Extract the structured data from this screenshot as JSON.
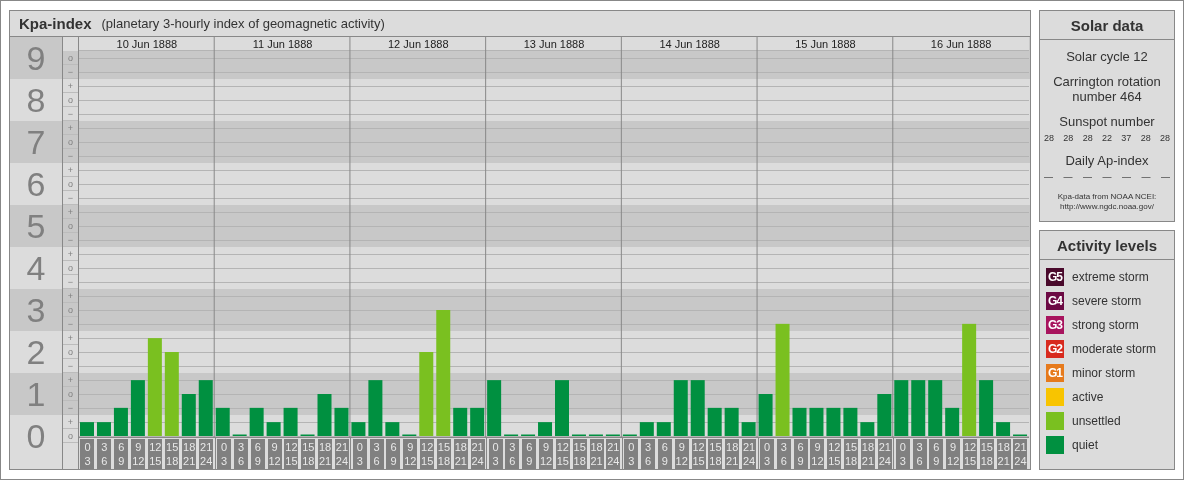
{
  "kp_panel": {
    "title": "Kpa-index",
    "subtitle": "(planetary 3-hourly index of geomagnetic activity)",
    "days": [
      {
        "date": "10 Jun 1888",
        "slots": [
          {
            "from": "0",
            "to": "3"
          },
          {
            "from": "3",
            "to": "6"
          },
          {
            "from": "6",
            "to": "9"
          },
          {
            "from": "9",
            "to": "12"
          },
          {
            "from": "12",
            "to": "15"
          },
          {
            "from": "15",
            "to": "18"
          },
          {
            "from": "18",
            "to": "21"
          },
          {
            "from": "21",
            "to": "24"
          }
        ]
      },
      {
        "date": "11 Jun 1888",
        "slots": [
          {
            "from": "0",
            "to": "3"
          },
          {
            "from": "3",
            "to": "6"
          },
          {
            "from": "6",
            "to": "9"
          },
          {
            "from": "9",
            "to": "12"
          },
          {
            "from": "12",
            "to": "15"
          },
          {
            "from": "15",
            "to": "18"
          },
          {
            "from": "18",
            "to": "21"
          },
          {
            "from": "21",
            "to": "24"
          }
        ]
      },
      {
        "date": "12 Jun 1888",
        "slots": [
          {
            "from": "0",
            "to": "3"
          },
          {
            "from": "3",
            "to": "6"
          },
          {
            "from": "6",
            "to": "9"
          },
          {
            "from": "9",
            "to": "12"
          },
          {
            "from": "12",
            "to": "15"
          },
          {
            "from": "15",
            "to": "18"
          },
          {
            "from": "18",
            "to": "21"
          },
          {
            "from": "21",
            "to": "24"
          }
        ]
      },
      {
        "date": "13 Jun 1888",
        "slots": [
          {
            "from": "0",
            "to": "3"
          },
          {
            "from": "3",
            "to": "6"
          },
          {
            "from": "6",
            "to": "9"
          },
          {
            "from": "9",
            "to": "12"
          },
          {
            "from": "12",
            "to": "15"
          },
          {
            "from": "15",
            "to": "18"
          },
          {
            "from": "18",
            "to": "21"
          },
          {
            "from": "21",
            "to": "24"
          }
        ]
      },
      {
        "date": "14 Jun 1888",
        "slots": [
          {
            "from": "0",
            "to": "3"
          },
          {
            "from": "3",
            "to": "6"
          },
          {
            "from": "6",
            "to": "9"
          },
          {
            "from": "9",
            "to": "12"
          },
          {
            "from": "12",
            "to": "15"
          },
          {
            "from": "15",
            "to": "18"
          },
          {
            "from": "18",
            "to": "21"
          },
          {
            "from": "21",
            "to": "24"
          }
        ]
      },
      {
        "date": "15 Jun 1888",
        "slots": [
          {
            "from": "0",
            "to": "3"
          },
          {
            "from": "3",
            "to": "6"
          },
          {
            "from": "6",
            "to": "9"
          },
          {
            "from": "9",
            "to": "12"
          },
          {
            "from": "12",
            "to": "15"
          },
          {
            "from": "15",
            "to": "18"
          },
          {
            "from": "18",
            "to": "21"
          },
          {
            "from": "21",
            "to": "24"
          }
        ]
      },
      {
        "date": "16 Jun 1888",
        "slots": [
          {
            "from": "0",
            "to": "3"
          },
          {
            "from": "3",
            "to": "6"
          },
          {
            "from": "6",
            "to": "9"
          },
          {
            "from": "9",
            "to": "12"
          },
          {
            "from": "12",
            "to": "15"
          },
          {
            "from": "15",
            "to": "18"
          },
          {
            "from": "18",
            "to": "21"
          },
          {
            "from": "21",
            "to": "24"
          }
        ]
      }
    ],
    "grade_marks": [
      "o",
      "−",
      "+",
      "o",
      "−",
      "+",
      "o",
      "−",
      "+",
      "o",
      "−",
      "+",
      "o",
      "−",
      "+",
      "o",
      "−",
      "+",
      "o",
      "−",
      "+",
      "o",
      "−",
      "+",
      "o",
      "−",
      "+",
      "o"
    ],
    "chart_data": {
      "type": "bar",
      "ylim": [
        0,
        9
      ],
      "grid": true,
      "yticks": [
        {
          "value": 0,
          "label": "0"
        },
        {
          "value": 1,
          "label": "1"
        },
        {
          "value": 2,
          "label": "2"
        },
        {
          "value": 3,
          "label": "3"
        },
        {
          "value": 4,
          "label": "4"
        },
        {
          "value": 5,
          "label": "5"
        },
        {
          "value": 6,
          "label": "6"
        },
        {
          "value": 7,
          "label": "7"
        },
        {
          "value": 8,
          "label": "8"
        },
        {
          "value": 9,
          "label": "9"
        }
      ],
      "values": [
        0.33,
        0.33,
        0.67,
        1.33,
        2.33,
        2.0,
        1.0,
        1.33,
        0.67,
        0,
        0.67,
        0.33,
        0.67,
        0,
        1.0,
        0.67,
        0.33,
        1.33,
        0.33,
        0,
        2.0,
        3.0,
        0.67,
        0.67,
        1.33,
        0,
        0,
        0.33,
        1.33,
        0,
        0,
        0,
        0,
        0.33,
        0.33,
        1.33,
        1.33,
        0.67,
        0.67,
        0.33,
        1.0,
        2.67,
        0.67,
        0.67,
        0.67,
        0.67,
        0.33,
        1.0,
        1.33,
        1.33,
        1.33,
        0.67,
        2.67,
        1.33,
        0.33,
        0
      ]
    }
  },
  "solar_data": {
    "title": "Solar data",
    "solar_cycle": "Solar cycle 12",
    "carrington_rotation": "Carrington rotation number 464",
    "sunspot_heading": "Sunspot number",
    "sunspot_numbers": [
      "28",
      "28",
      "28",
      "22",
      "37",
      "28",
      "28"
    ],
    "ap_heading": "Daily Ap-index",
    "ap_values": [
      "—",
      "—",
      "—",
      "—",
      "—",
      "—",
      "—"
    ],
    "source": "Kpa-data from NOAA NCEI:",
    "source_url": "http://www.ngdc.noaa.gov/"
  },
  "activity_levels": {
    "title": "Activity levels",
    "items": [
      {
        "badge": "G5",
        "label": "extreme storm",
        "color": "#4a0a2c"
      },
      {
        "badge": "G4",
        "label": "severe storm",
        "color": "#6c0a44"
      },
      {
        "badge": "G3",
        "label": "strong storm",
        "color": "#a8145e"
      },
      {
        "badge": "G2",
        "label": "moderate storm",
        "color": "#d82a1e"
      },
      {
        "badge": "G1",
        "label": "minor storm",
        "color": "#e67a1c"
      },
      {
        "label": "active",
        "color": "#f8c400"
      },
      {
        "label": "unsettled",
        "color": "#7ac020"
      },
      {
        "label": "quiet",
        "color": "#009040"
      }
    ]
  }
}
